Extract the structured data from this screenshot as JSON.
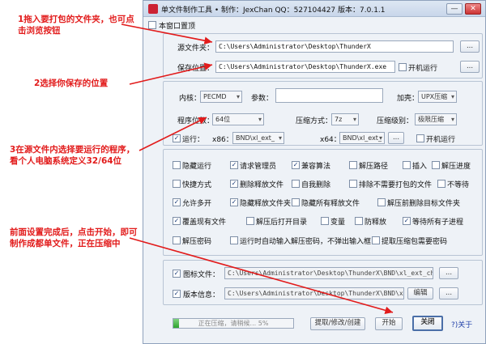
{
  "window": {
    "title": "单文件制作工具 • 制作：JexChan  QQ：527104427  版本：7.0.1.1",
    "minimize": "—",
    "close": "✕"
  },
  "topmost": {
    "label": "本窗口置顶",
    "checked": false
  },
  "source": {
    "label": "源文件夹：",
    "value": "C:\\Users\\Administrator\\Desktop\\ThunderX",
    "browse": "..."
  },
  "save": {
    "label": "保存位置：",
    "value": "C:\\Users\\Administrator\\Desktop\\ThunderX.exe",
    "autorun_label": "开机运行",
    "browse": "..."
  },
  "kernel": {
    "label": "内核：",
    "value": "PECMD"
  },
  "params": {
    "label": "参数：",
    "value": ""
  },
  "shell": {
    "label": "加壳：",
    "value": "UPX压缩"
  },
  "bitness": {
    "label": "程序位数：",
    "value": "64位"
  },
  "compress_method": {
    "label": "压缩方式：",
    "value": "7z"
  },
  "compress_level": {
    "label": "压缩级别：",
    "value": "极限压缩"
  },
  "run": {
    "label": "运行：",
    "x86_label": "x86：",
    "x86_value": "BND\\xl_ext_",
    "x64_label": "x64：",
    "x64_value": "BND\\xl_ext_",
    "autorun_label": "开机运行",
    "browse": "..."
  },
  "options": [
    {
      "label": "隐藏运行",
      "checked": false
    },
    {
      "label": "请求管理员",
      "checked": true
    },
    {
      "label": "兼容算法",
      "checked": true
    },
    {
      "label": "解压路径",
      "checked": false
    },
    {
      "label": "插入",
      "checked": false
    },
    {
      "label": "解压进度",
      "checked": false
    },
    {
      "label": "快捷方式",
      "checked": false
    },
    {
      "label": "删除释放文件",
      "checked": true
    },
    {
      "label": "自我删除",
      "checked": false
    },
    {
      "label": "排除不需要打包的文件",
      "checked": false
    },
    {
      "label": "不等待",
      "checked": false
    },
    {
      "label": "允许多开",
      "checked": true
    },
    {
      "label": "隐藏释放文件夹",
      "checked": true
    },
    {
      "label": "隐藏所有释放文件",
      "checked": false
    },
    {
      "label": "解压前删除目标文件夹",
      "checked": false
    },
    {
      "label": "覆盖现有文件",
      "checked": true
    },
    {
      "label": "解压后打开目录",
      "checked": false
    },
    {
      "label": "变量",
      "checked": false
    },
    {
      "label": "防释放",
      "checked": false
    },
    {
      "label": "等待所有子进程",
      "checked": true
    },
    {
      "label": "解压密码",
      "checked": false
    },
    {
      "label": "运行时自动输入解压密码，不弹出输入框",
      "checked": false
    },
    {
      "label": "提取压缩包需要密码",
      "checked": false
    }
  ],
  "icon_file": {
    "label": "图标文件：",
    "value": "C:\\Users\\Administrator\\Desktop\\ThunderX\\BND\\xl_ext_chrom",
    "checked": true,
    "browse": "..."
  },
  "version_info": {
    "label": "版本信息：",
    "value": "C:\\Users\\Administrator\\Desktop\\ThunderX\\BND\\xl_e",
    "checked": true,
    "edit": "编辑",
    "browse": "..."
  },
  "bottom": {
    "progress_text": "正在压缩，请稍候...    5%",
    "progress_pct": 5,
    "extract_btn": "提取/修改/创建",
    "start_btn": "开始",
    "close_btn": "关闭",
    "help": "?)关于"
  },
  "annotations": {
    "n1": "1拖入要打包的文件夹，也可点击浏览按钮",
    "n2": "2选择你保存的位置",
    "n3": "3在源文件内选择要运行的程序，看个人电脑系统定义32/64位",
    "n4": "前面设置完成后，点击开始，即可制作成都单文件，正在压缩中"
  },
  "colors": {
    "annotation": "#e21b1b",
    "accent": "#2ea42e"
  }
}
